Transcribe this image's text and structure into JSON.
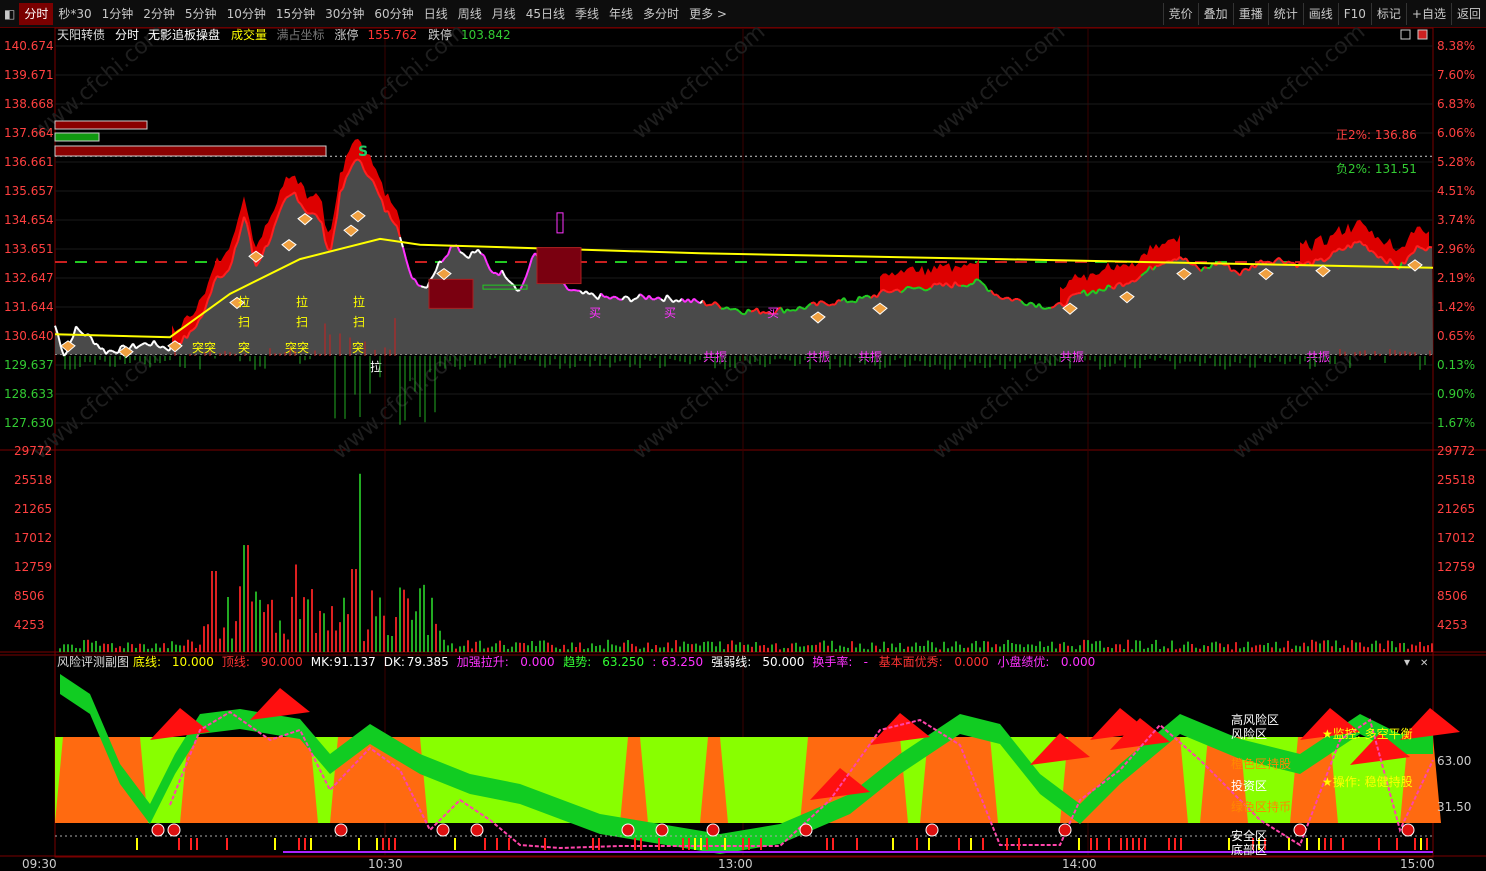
{
  "toolbar": {
    "left_icon": "window-menu-icon",
    "periods": [
      "分时",
      "秒*30",
      "1分钟",
      "2分钟",
      "5分钟",
      "10分钟",
      "15分钟",
      "30分钟",
      "60分钟",
      "日线",
      "周线",
      "月线",
      "45日线",
      "季线",
      "年线",
      "多分时",
      "更多 >"
    ],
    "active_index": 0,
    "right": [
      "竞价",
      "叠加",
      "重播",
      "统计",
      "画线",
      "F10",
      "标记",
      "+自选",
      "返回"
    ]
  },
  "main": {
    "stock_name": "天阳转债",
    "mode": "分时",
    "indicator": "无影追板操盘",
    "volume_label": "成交量",
    "coord_label": "满占坐标",
    "limit_up_label": "涨停",
    "limit_up_value": "155.762",
    "limit_down_label": "跌停",
    "limit_down_value": "103.842",
    "price_ticks": [
      "140.674",
      "139.671",
      "138.668",
      "137.664",
      "136.661",
      "135.657",
      "134.654",
      "133.651",
      "132.647",
      "131.644",
      "130.640",
      "129.637",
      "128.633",
      "127.630"
    ],
    "pct_ticks": [
      "8.38%",
      "7.60%",
      "6.83%",
      "6.06%",
      "5.28%",
      "4.51%",
      "3.74%",
      "2.96%",
      "2.19%",
      "1.42%",
      "0.65%",
      "0.13%",
      "0.90%",
      "1.67%"
    ],
    "pos2_label": "正2%: 136.86",
    "neg2_label": "负2%: 131.51",
    "s_marker": "S",
    "buy_label": "买",
    "pull_label": "拉",
    "sweep_label": "扫",
    "break_label": "突",
    "resonance_label": "共振"
  },
  "volume": {
    "ticks": [
      "29772",
      "25518",
      "21265",
      "17012",
      "12759",
      "8506",
      "4253"
    ]
  },
  "sub": {
    "title": "风险评测副图",
    "items": [
      {
        "label": "底线:",
        "value": "10.000",
        "color": "#ffff00"
      },
      {
        "label": "顶线:",
        "value": "90.000",
        "color": "#ff3333"
      },
      {
        "label": "MK:",
        "value": "91.137",
        "color": "#ffffff"
      },
      {
        "label": "DK:",
        "value": "79.385",
        "color": "#ffffff"
      },
      {
        "label": "加强拉升:",
        "value": "0.000",
        "color": "#ff33ff"
      },
      {
        "label": "趋势:",
        "value": "63.250",
        "color": "#33ff33"
      },
      {
        "label": ":",
        "value": "63.250",
        "color": "#ff33ff"
      },
      {
        "label": "强弱线:",
        "value": "50.000",
        "color": "#ffffff"
      },
      {
        "label": "换手率:",
        "value": "-",
        "color": "#ff33ff"
      },
      {
        "label": "基本面优秀:",
        "value": "0.000",
        "color": "#ff3333"
      },
      {
        "label": "小盘绩优:",
        "value": "0.000",
        "color": "#ff33ff"
      }
    ],
    "ticks": [
      "63.00",
      "31.50"
    ],
    "zones": [
      "高风险区",
      "风险区",
      "橙色区持股",
      "投资区",
      "绿色区持币",
      "安全区",
      "底部区"
    ],
    "monitor_label": "★监控: 多空平衡",
    "operate_label": "★操作: 稳健持股"
  },
  "time_axis": [
    "09:30",
    "10:30",
    "13:00",
    "14:00",
    "15:00"
  ],
  "watermark": "www.cfchi.com",
  "colors": {
    "up": "#ff2020",
    "down": "#22cc22",
    "price_line": "#ffffff",
    "avg_line": "#ffff00",
    "accent": "#ff00ff"
  }
}
